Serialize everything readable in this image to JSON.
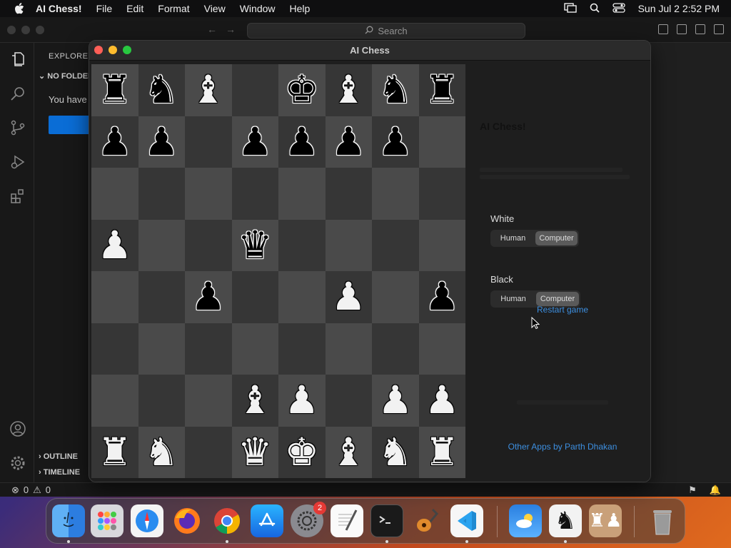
{
  "menubar": {
    "app_name": "AI Chess!",
    "items": [
      "File",
      "Edit",
      "Format",
      "View",
      "Window",
      "Help"
    ],
    "clock": "Sun Jul 2  2:52 PM"
  },
  "vscode": {
    "search_label": "Search",
    "explorer_title": "EXPLORER",
    "no_folder": "NO FOLDER",
    "you_have": "You have",
    "outline": "OUTLINE",
    "timeline": "TIMELINE",
    "errors_count": "0",
    "warnings_count": "0"
  },
  "chess_window": {
    "title": "AI Chess",
    "app_heading": "AI Chess!",
    "white_label": "White",
    "black_label": "Black",
    "human_label": "Human",
    "computer_label": "Computer",
    "white_selected": "Computer",
    "black_selected": "Computer",
    "restart_label": "Restart game",
    "other_apps_label": "Other Apps by Parth Dhakan"
  },
  "board": [
    [
      "bR",
      "bN",
      "wB",
      "",
      "bK",
      "wB",
      "bN",
      "bR"
    ],
    [
      "bP",
      "bP",
      "",
      "bP",
      "bP",
      "bP",
      "bP",
      ""
    ],
    [
      "",
      "",
      "",
      "",
      "",
      "",
      "",
      ""
    ],
    [
      "wP",
      "",
      "",
      "bQ",
      "",
      "",
      "",
      ""
    ],
    [
      "",
      "",
      "bP",
      "",
      "",
      "wP",
      "",
      "bP"
    ],
    [
      "",
      "",
      "",
      "",
      "",
      "",
      "",
      ""
    ],
    [
      "",
      "",
      "",
      "wB",
      "wP",
      "",
      "wP",
      "wP"
    ],
    [
      "wR",
      "wN",
      "",
      "wQ",
      "wK",
      "wB",
      "wN",
      "wR"
    ]
  ],
  "dock": {
    "apps": [
      "Finder",
      "Launchpad",
      "Safari",
      "Firefox",
      "Chrome",
      "App Store",
      "System Settings",
      "TextEdit",
      "Terminal",
      "GarageBand",
      "Visual Studio Code",
      "Weather",
      "AI Chess",
      "Chess"
    ],
    "system_settings_badge": "2",
    "trash": "Trash"
  }
}
